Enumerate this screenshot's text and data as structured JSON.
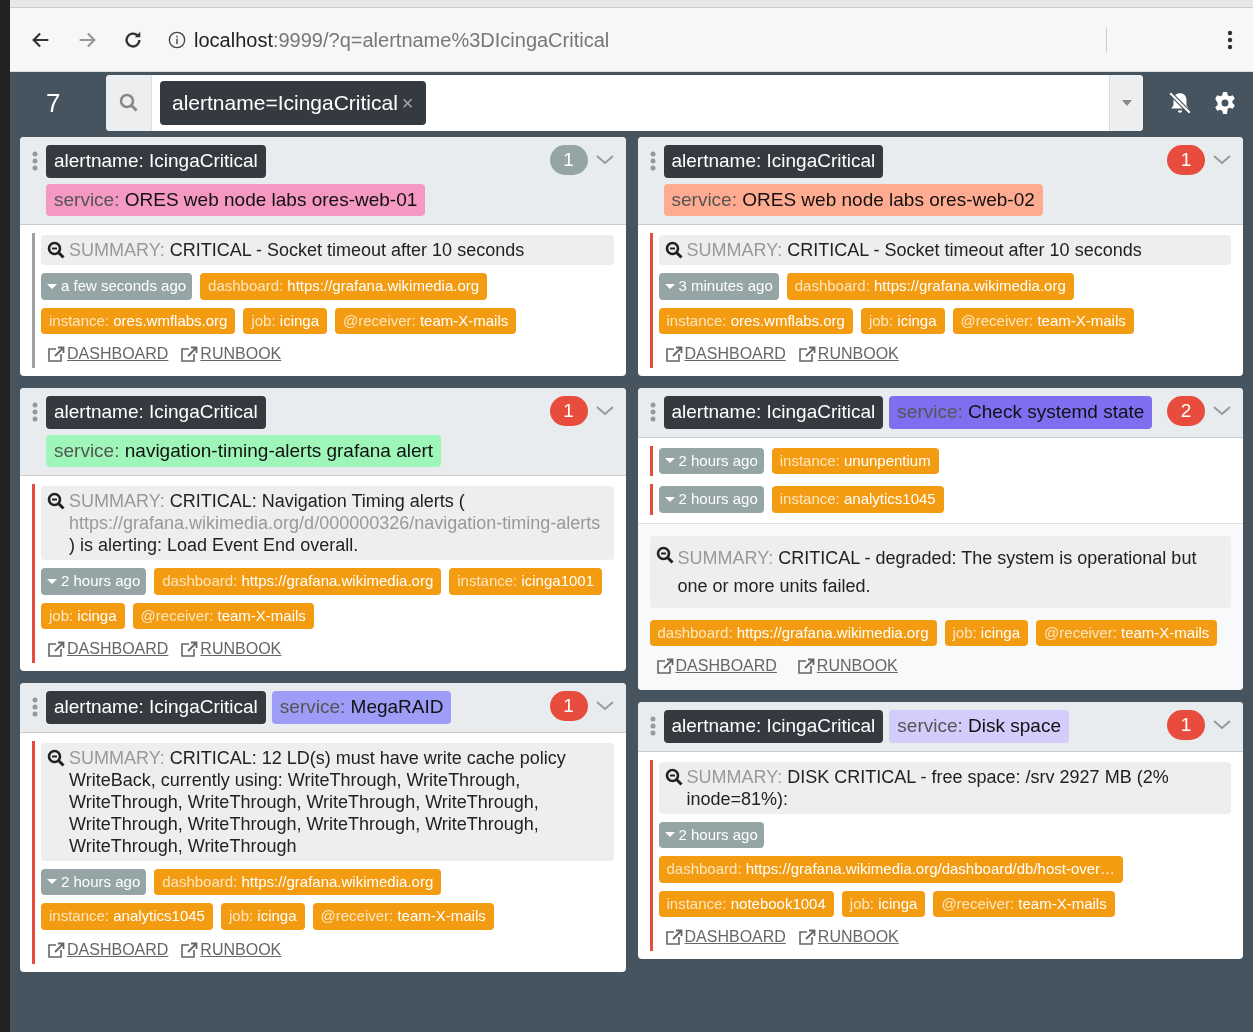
{
  "browser": {
    "url_host": "localhost",
    "url_rest": ":9999/?q=alertname%3DIcingaCritical"
  },
  "navbar": {
    "alert_count": "7",
    "filters": [
      {
        "text": "alertname=IcingaCritical",
        "remove": "×"
      }
    ]
  },
  "columns": [
    {
      "cards": [
        {
          "labels": [
            {
              "key": "alertname:",
              "value": "IcingaCritical",
              "color": "#343a40"
            },
            {
              "key": "service:",
              "value": "ORES web node labs ores-web-01",
              "color": "#f598c4"
            }
          ],
          "count": {
            "text": "1",
            "color": "#95a5a6"
          },
          "alerts": [
            {
              "color": "#a0a0a0",
              "summary": {
                "key": "SUMMARY:",
                "parts": [
                  {
                    "kind": "text",
                    "text": "CRITICAL - Socket timeout after 10 seconds"
                  }
                ]
              },
              "time": "a few seconds ago",
              "labels": [
                {
                  "key": "dashboard:",
                  "value": "https://grafana.wikimedia.org"
                },
                {
                  "key": "instance:",
                  "value": "ores.wmflabs.org"
                },
                {
                  "key": "job:",
                  "value": "icinga"
                },
                {
                  "key": "@receiver:",
                  "value": "team-X-mails"
                }
              ],
              "links": [
                "DASHBOARD",
                "RUNBOOK"
              ]
            }
          ]
        },
        {
          "labels": [
            {
              "key": "alertname:",
              "value": "IcingaCritical",
              "color": "#343a40"
            },
            {
              "key": "service:",
              "value": "navigation-timing-alerts grafana alert",
              "color": "#9ef7b9"
            }
          ],
          "count": {
            "text": "1",
            "color": "#e74c3c"
          },
          "alerts": [
            {
              "color": "#e74c3c",
              "summary": {
                "key": "SUMMARY:",
                "parts": [
                  {
                    "kind": "text",
                    "text": "CRITICAL: Navigation Timing alerts ( "
                  },
                  {
                    "kind": "url",
                    "text": "https://grafana.wikimedia.org/d/000000326/navigation-timing-alerts"
                  },
                  {
                    "kind": "text",
                    "text": " ) is alerting: Load Event End overall."
                  }
                ]
              },
              "time": "2 hours ago",
              "labels": [
                {
                  "key": "dashboard:",
                  "value": "https://grafana.wikimedia.org"
                },
                {
                  "key": "instance:",
                  "value": "icinga1001"
                },
                {
                  "key": "job:",
                  "value": "icinga"
                },
                {
                  "key": "@receiver:",
                  "value": "team-X-mails"
                }
              ],
              "links": [
                "DASHBOARD",
                "RUNBOOK"
              ]
            }
          ]
        },
        {
          "labels": [
            {
              "key": "alertname:",
              "value": "IcingaCritical",
              "color": "#343a40"
            },
            {
              "key": "service:",
              "value": "MegaRAID",
              "color": "#9d9cf7"
            }
          ],
          "count": {
            "text": "1",
            "color": "#e74c3c"
          },
          "alerts": [
            {
              "color": "#e74c3c",
              "summary": {
                "key": "SUMMARY:",
                "parts": [
                  {
                    "kind": "text",
                    "text": "CRITICAL: 12 LD(s) must have write cache policy WriteBack, currently using: WriteThrough, WriteThrough, WriteThrough, WriteThrough, WriteThrough, WriteThrough, WriteThrough, WriteThrough, WriteThrough, WriteThrough, WriteThrough, WriteThrough"
                  }
                ]
              },
              "time": "2 hours ago",
              "labels": [
                {
                  "key": "dashboard:",
                  "value": "https://grafana.wikimedia.org"
                },
                {
                  "key": "instance:",
                  "value": "analytics1045"
                },
                {
                  "key": "job:",
                  "value": "icinga"
                },
                {
                  "key": "@receiver:",
                  "value": "team-X-mails"
                }
              ],
              "links": [
                "DASHBOARD",
                "RUNBOOK"
              ]
            }
          ]
        }
      ]
    },
    {
      "cards": [
        {
          "labels": [
            {
              "key": "alertname:",
              "value": "IcingaCritical",
              "color": "#343a40"
            },
            {
              "key": "service:",
              "value": "ORES web node labs ores-web-02",
              "color": "#ffab91"
            }
          ],
          "count": {
            "text": "1",
            "color": "#e74c3c"
          },
          "alerts": [
            {
              "color": "#e74c3c",
              "summary": {
                "key": "SUMMARY:",
                "parts": [
                  {
                    "kind": "text",
                    "text": "CRITICAL - Socket timeout after 10 seconds"
                  }
                ]
              },
              "time": "3 minutes ago",
              "labels": [
                {
                  "key": "dashboard:",
                  "value": "https://grafana.wikimedia.org"
                },
                {
                  "key": "instance:",
                  "value": "ores.wmflabs.org"
                },
                {
                  "key": "job:",
                  "value": "icinga"
                },
                {
                  "key": "@receiver:",
                  "value": "team-X-mails"
                }
              ],
              "links": [
                "DASHBOARD",
                "RUNBOOK"
              ]
            }
          ]
        },
        {
          "labels": [
            {
              "key": "alertname:",
              "value": "IcingaCritical",
              "color": "#343a40"
            },
            {
              "key": "service:",
              "value": "Check systemd state",
              "color": "#7f6ff0"
            }
          ],
          "count": {
            "text": "2",
            "color": "#e74c3c"
          },
          "alerts": [
            {
              "color": "#e74c3c",
              "time": "2 hours ago",
              "labels": [
                {
                  "key": "instance:",
                  "value": "ununpentium"
                }
              ]
            },
            {
              "color": "#e74c3c",
              "time": "2 hours ago",
              "labels": [
                {
                  "key": "instance:",
                  "value": "analytics1045"
                }
              ]
            }
          ],
          "shared": {
            "summary": {
              "key": "SUMMARY:",
              "parts": [
                {
                  "kind": "text",
                  "text": "CRITICAL - degraded: The system is operational but one or more units failed."
                }
              ]
            },
            "labels": [
              {
                "key": "dashboard:",
                "value": "https://grafana.wikimedia.org"
              },
              {
                "key": "job:",
                "value": "icinga"
              },
              {
                "key": "@receiver:",
                "value": "team-X-mails"
              }
            ],
            "links": [
              "DASHBOARD",
              "RUNBOOK"
            ]
          }
        },
        {
          "labels": [
            {
              "key": "alertname:",
              "value": "IcingaCritical",
              "color": "#343a40"
            },
            {
              "key": "service:",
              "value": "Disk space",
              "color": "#d4ccfa"
            }
          ],
          "count": {
            "text": "1",
            "color": "#e74c3c"
          },
          "alerts": [
            {
              "color": "#e74c3c",
              "summary": {
                "key": "SUMMARY:",
                "parts": [
                  {
                    "kind": "text",
                    "text": "DISK CRITICAL - free space: /srv 2927 MB (2% inode=81%):"
                  }
                ]
              },
              "time": "2 hours ago",
              "labels": [
                {
                  "key": "dashboard:",
                  "value": "https://grafana.wikimedia.org/dashboard/db/host-over…"
                },
                {
                  "key": "instance:",
                  "value": "notebook1004"
                },
                {
                  "key": "job:",
                  "value": "icinga"
                },
                {
                  "key": "@receiver:",
                  "value": "team-X-mails"
                }
              ],
              "links": [
                "DASHBOARD",
                "RUNBOOK"
              ]
            }
          ]
        }
      ]
    }
  ]
}
